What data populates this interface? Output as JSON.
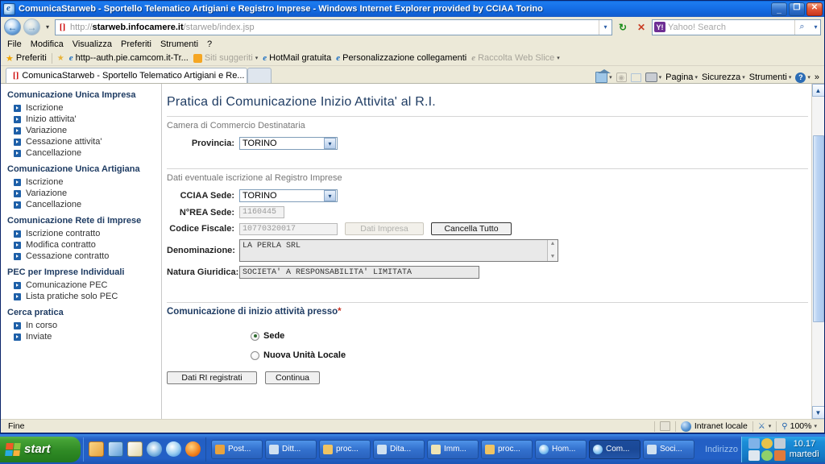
{
  "window": {
    "title": "ComunicaStarweb - Sportello Telematico Artigiani e Registro Imprese - Windows Internet Explorer provided by CCIAA Torino",
    "minimize_glyph": "_",
    "restore_glyph": "❐",
    "close_glyph": "✕"
  },
  "address_bar": {
    "back_glyph": "←",
    "forward_glyph": "→",
    "history_caret": "▾",
    "url_prefix": "http://",
    "url_domain": "starweb.infocamere.it",
    "url_path": "/starweb/index.jsp",
    "url_caret": "▾",
    "refresh_glyph": "↻",
    "stop_glyph": "✕",
    "search_placeholder": "Yahoo! Search",
    "search_brand": "Y!",
    "search_go_glyph": "⌕",
    "search_caret": "▾"
  },
  "menu": {
    "items": [
      "File",
      "Modifica",
      "Visualizza",
      "Preferiti",
      "Strumenti",
      "?"
    ]
  },
  "favorites_bar": {
    "favorites_label": "Preferiti",
    "items": [
      {
        "label": "http--auth.pie.camcom.it-Tr...",
        "icon": "ie-icon",
        "dimmed": false,
        "caret": false
      },
      {
        "label": "Siti suggeriti",
        "icon": "suggested-sites-icon",
        "dimmed": true,
        "caret": true
      },
      {
        "label": "HotMail gratuita",
        "icon": "ie-icon",
        "dimmed": false,
        "caret": false
      },
      {
        "label": "Personalizzazione collegamenti",
        "icon": "ie-icon",
        "dimmed": false,
        "caret": false
      },
      {
        "label": "Raccolta Web Slice",
        "icon": "ie-icon",
        "dimmed": true,
        "caret": true
      }
    ]
  },
  "tabs": {
    "active_tab": "ComunicaStarweb - Sportello Telematico Artigiani e Re...",
    "new_tab_label": "",
    "tools": [
      {
        "label": "",
        "icon": "home-icon",
        "caret": true
      },
      {
        "label": "",
        "icon": "feeds-icon",
        "caret": false
      },
      {
        "label": "",
        "icon": "read-mail-icon",
        "caret": false
      },
      {
        "label": "",
        "icon": "print-icon",
        "caret": true
      },
      {
        "label": "Pagina",
        "icon": "page-menu",
        "caret": true
      },
      {
        "label": "Sicurezza",
        "icon": "security-menu",
        "caret": true
      },
      {
        "label": "Strumenti",
        "icon": "tools-menu",
        "caret": true
      },
      {
        "label": "",
        "icon": "help-icon",
        "caret": true
      }
    ],
    "overflow_glyph": "»"
  },
  "sidebar": {
    "groups": [
      {
        "heading": "Comunicazione Unica Impresa",
        "items": [
          "Iscrizione",
          "Inizio attivita'",
          "Variazione",
          "Cessazione attivita'",
          "Cancellazione"
        ]
      },
      {
        "heading": "Comunicazione Unica Artigiana",
        "items": [
          "Iscrizione",
          "Variazione",
          "Cancellazione"
        ]
      },
      {
        "heading": "Comunicazione Rete di Imprese",
        "items": [
          "Iscrizione contratto",
          "Modifica contratto",
          "Cessazione contratto"
        ]
      },
      {
        "heading": "PEC per Imprese Individuali",
        "items": [
          "Comunicazione PEC",
          "Lista pratiche solo PEC"
        ]
      },
      {
        "heading": "Cerca pratica",
        "items": [
          "In corso",
          "Inviate"
        ]
      }
    ]
  },
  "main": {
    "page_title": "Pratica di Comunicazione Inizio Attivita' al R.I.",
    "section1_label": "Camera di Commercio Destinataria",
    "provincia_label": "Provincia:",
    "provincia_value": "TORINO",
    "section2_label": "Dati eventuale iscrizione al Registro Imprese",
    "cciaa_label": "CCIAA Sede:",
    "cciaa_value": "TORINO",
    "rea_label": "N°REA Sede:",
    "rea_value": "1160445",
    "cf_label": "Codice Fiscale:",
    "cf_value": "10770320017",
    "dati_impresa_button": "Dati Impresa",
    "cancella_tutto_button": "Cancella Tutto",
    "denominazione_label": "Denominazione:",
    "denominazione_value": "LA PERLA SRL",
    "natura_label": "Natura Giuridica:",
    "natura_value": "SOCIETA' A RESPONSABILITA' LIMITATA",
    "section3_label": "Comunicazione di inizio attività presso",
    "section3_required_marker": "*",
    "radio_sede": "Sede",
    "radio_nuova_ul": "Nuova Unità Locale",
    "radio_selected": "Sede",
    "dati_ri_button": "Dati RI registrati",
    "continua_button": "Continua",
    "dropdown_caret": "▾",
    "scroll_up_glyph": "▲",
    "scroll_down_glyph": "▼"
  },
  "status_bar": {
    "status_text": "Fine",
    "zone_text": "Intranet locale",
    "zoom_text": "100%",
    "zoom_caret": "▾",
    "protect_caret": "▾"
  },
  "taskbar": {
    "start_label": "start",
    "quick_launch": [
      "outlook-icon",
      "showdesktop-icon",
      "paint-icon",
      "mediaplayer-icon",
      "ie-icon",
      "firefox-icon"
    ],
    "tasks": [
      {
        "label": "Post...",
        "icon": "outlook-icon",
        "active": false
      },
      {
        "label": "Ditt...",
        "icon": "excel-icon",
        "active": false
      },
      {
        "label": "proc...",
        "icon": "folder-icon",
        "active": false
      },
      {
        "label": "Dita...",
        "icon": "excel-icon",
        "active": false
      },
      {
        "label": "Imm...",
        "icon": "paint-icon",
        "active": false
      },
      {
        "label": "proc...",
        "icon": "folder-icon",
        "active": false
      },
      {
        "label": "Hom...",
        "icon": "ie-icon",
        "active": false
      },
      {
        "label": "Com...",
        "icon": "ie-icon",
        "active": true
      },
      {
        "label": "Soci...",
        "icon": "excel-icon",
        "active": false
      }
    ],
    "address_label": "Indirizzo",
    "clock_time": "10.17",
    "clock_day": "martedì"
  },
  "colors": {
    "title_blue": "#1671e8",
    "sidebar_heading": "#1f3c63",
    "accent_blue": "#1d5fa8",
    "required_red": "#cc3322",
    "taskbar_blue": "#235fc4",
    "start_green": "#2f8a25"
  }
}
